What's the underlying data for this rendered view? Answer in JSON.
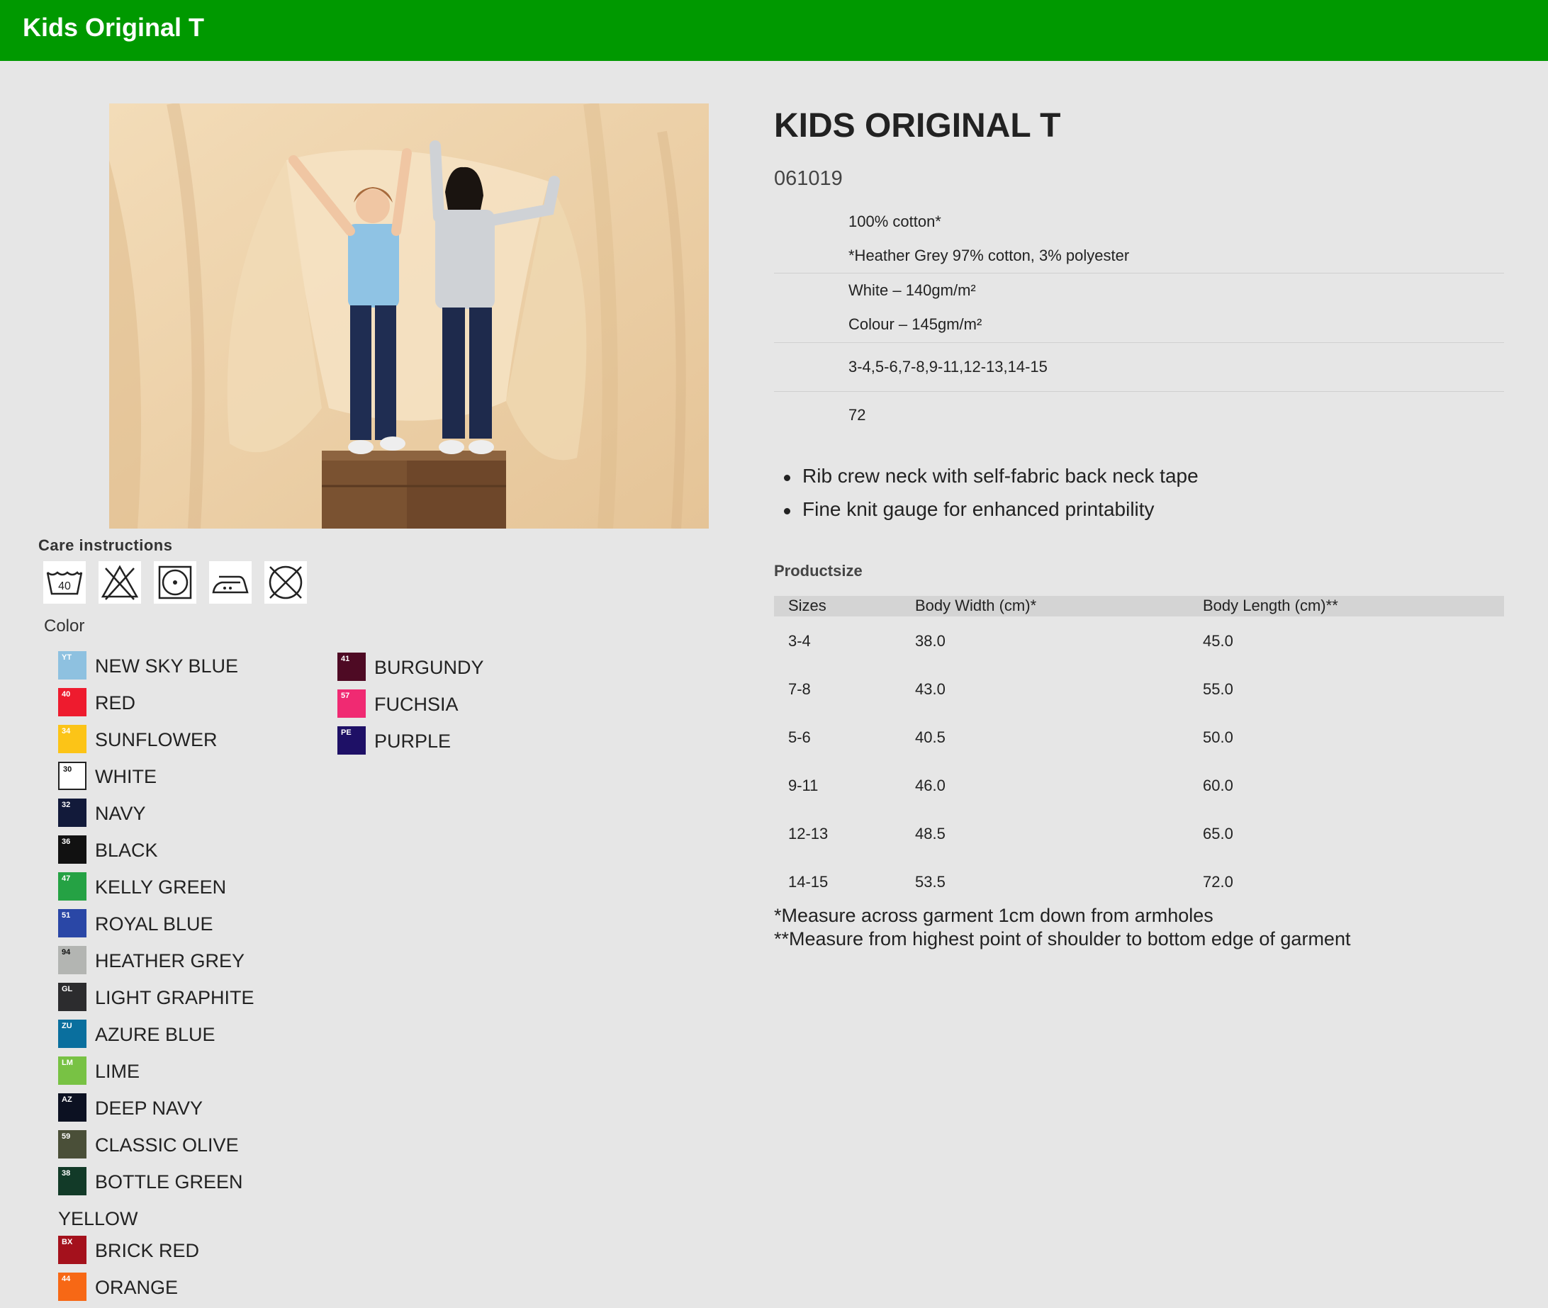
{
  "header": {
    "title": "Kids Original T"
  },
  "care": {
    "heading": "Care instructions",
    "icons": [
      {
        "name": "wash-40-icon",
        "label": "40"
      },
      {
        "name": "no-bleach-icon"
      },
      {
        "name": "tumble-dry-icon"
      },
      {
        "name": "iron-icon"
      },
      {
        "name": "no-dry-clean-icon"
      }
    ]
  },
  "colors": {
    "heading": "Color",
    "items": [
      {
        "code": "YT",
        "name": "NEW SKY BLUE",
        "hex": "#8ec1e0"
      },
      {
        "code": "40",
        "name": "RED",
        "hex": "#ee1b2e"
      },
      {
        "code": "34",
        "name": "SUNFLOWER",
        "hex": "#fcc417"
      },
      {
        "code": "30",
        "name": "WHITE",
        "hex": "#ffffff",
        "light": true
      },
      {
        "code": "32",
        "name": "NAVY",
        "hex": "#121a3a"
      },
      {
        "code": "36",
        "name": "BLACK",
        "hex": "#111111"
      },
      {
        "code": "47",
        "name": "KELLY GREEN",
        "hex": "#25a244"
      },
      {
        "code": "51",
        "name": "ROYAL BLUE",
        "hex": "#2a47a6"
      },
      {
        "code": "94",
        "name": "HEATHER GREY",
        "hex": "#b3b5b2",
        "light": true
      },
      {
        "code": "GL",
        "name": "LIGHT GRAPHITE",
        "hex": "#2c2c2e"
      },
      {
        "code": "ZU",
        "name": "AZURE BLUE",
        "hex": "#0a6f9e"
      },
      {
        "code": "LM",
        "name": "LIME",
        "hex": "#78c244"
      },
      {
        "code": "AZ",
        "name": "DEEP NAVY",
        "hex": "#0c1122"
      },
      {
        "code": "59",
        "name": "CLASSIC OLIVE",
        "hex": "#4a4f38"
      },
      {
        "code": "38",
        "name": "BOTTLE GREEN",
        "hex": "#123a28"
      },
      {
        "code": "",
        "name": "YELLOW",
        "hex": ""
      },
      {
        "code": "BX",
        "name": "BRICK RED",
        "hex": "#a4111c"
      },
      {
        "code": "44",
        "name": "ORANGE",
        "hex": "#f76815"
      },
      {
        "code": "41",
        "name": "BURGUNDY",
        "hex": "#4e0a24"
      },
      {
        "code": "57",
        "name": "FUCHSIA",
        "hex": "#f02a72"
      },
      {
        "code": "PE",
        "name": "PURPLE",
        "hex": "#1e1066"
      }
    ]
  },
  "product": {
    "title": "KIDS ORIGINAL T",
    "code": "061019",
    "fabric": [
      "100% cotton*",
      "*Heather Grey 97% cotton, 3% polyester"
    ],
    "weight": [
      "White – 140gm/m²",
      "Colour – 145gm/m²"
    ],
    "sizes": "3-4,5-6,7-8,9-11,12-13,14-15",
    "pack": "72",
    "features": [
      "Rib crew neck with self-fabric back neck tape",
      "Fine knit gauge for enhanced printability"
    ]
  },
  "productsize": {
    "heading": "Productsize",
    "columns": [
      "Sizes",
      "Body Width (cm)*",
      "Body Length (cm)**"
    ],
    "rows": [
      [
        "3-4",
        "38.0",
        "45.0"
      ],
      [
        "7-8",
        "43.0",
        "55.0"
      ],
      [
        "5-6",
        "40.5",
        "50.0"
      ],
      [
        "9-11",
        "46.0",
        "60.0"
      ],
      [
        "12-13",
        "48.5",
        "65.0"
      ],
      [
        "14-15",
        "53.5",
        "72.0"
      ]
    ],
    "notes": [
      "*Measure across garment 1cm down from armholes",
      "**Measure from highest point of shoulder to bottom edge of garment"
    ]
  }
}
